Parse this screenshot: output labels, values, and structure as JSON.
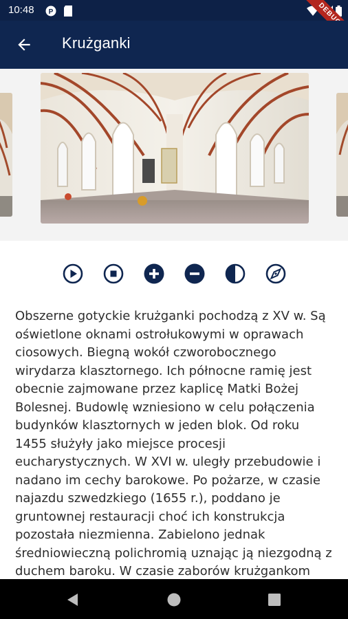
{
  "status_bar": {
    "time": "10:48",
    "debug_label": "DEBUG"
  },
  "app_bar": {
    "title": "Krużganki",
    "back_icon": "arrow-left-icon"
  },
  "gallery": {
    "images": [
      {
        "description": "cloister-partial-left"
      },
      {
        "description": "gothic-cloister-vaulted-corridor"
      },
      {
        "description": "cloister-partial-right"
      }
    ]
  },
  "controls": [
    {
      "icon": "play-circle-icon"
    },
    {
      "icon": "stop-circle-icon"
    },
    {
      "icon": "zoom-in-icon"
    },
    {
      "icon": "zoom-out-icon"
    },
    {
      "icon": "contrast-icon"
    },
    {
      "icon": "compass-icon"
    }
  ],
  "description": "Obszerne gotyckie krużganki pochodzą z XV w. Są oświetlone oknami ostrołukowymi w oprawach ciosowych. Biegną wokół czworobocznego wirydarza klasztornego. Ich północne ramię jest obecnie zajmowane przez kaplicę Matki Bożej Bolesnej. Budowlę wzniesiono w celu połączenia budynków klasztornych w jeden blok. Od roku 1455 służyły jako miejsce procesji eucharystycznych. W XVI w. uległy przebudowie i nadano im cechy barokowe. Po pożarze, w czasie najazdu szwedzkiego (1655 r.), poddano je gruntownej restauracji choć ich konstrukcja pozostała niezmienna. Zabielono jednak średniowieczną polichromią uznając ją niezgodną z duchem baroku. W czasie zaborów krużgankom",
  "colors": {
    "app_bar": "#0f2650",
    "status_bar": "#0d2147",
    "icon": "#0f2650",
    "text": "#2d2d2d"
  },
  "nav_bar": {
    "icons": [
      "back-triangle-icon",
      "home-circle-icon",
      "recents-square-icon"
    ]
  }
}
